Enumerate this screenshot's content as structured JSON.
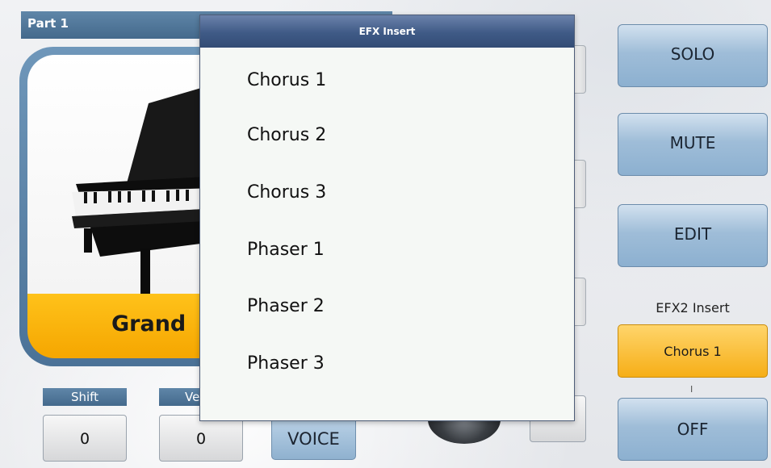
{
  "part": {
    "title": "Part 1"
  },
  "voice": {
    "name": "Grand"
  },
  "controls": {
    "shift_label": "Shift",
    "shift_value": "0",
    "velocity_label": "Ve",
    "velocity_value": "0",
    "voice_button": "VOICE"
  },
  "right_buttons": {
    "solo": "SOLO",
    "mute": "MUTE",
    "edit": "EDIT",
    "efx2_label": "EFX2 Insert",
    "efx2_value": "Chorus 1",
    "off": "OFF"
  },
  "popup": {
    "title": "EFX Insert",
    "items": [
      "Chorus 1",
      "Chorus 2",
      "Chorus 3",
      "Phaser 1",
      "Phaser 2",
      "Phaser 3"
    ]
  },
  "colors": {
    "header_blue": "#44698c",
    "accent_orange": "#f5a600",
    "popup_title": "#3f5a86"
  }
}
